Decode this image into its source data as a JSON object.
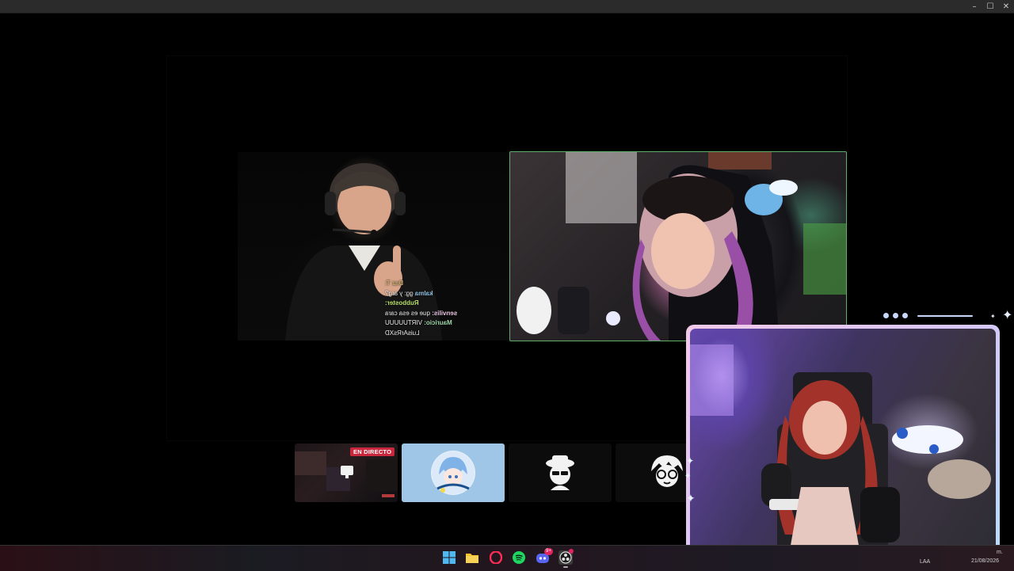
{
  "window": {
    "controls": {
      "minimize": "–",
      "maximize": "☐",
      "close": "✕"
    }
  },
  "stage": {
    "chat_overlay": [
      {
        "user": "Daz T:",
        "message": ""
      },
      {
        "user": "kalma",
        "message": "gg: y arg?"
      },
      {
        "user": "Rubboster:",
        "message": ""
      },
      {
        "user": "senvilis:",
        "message": "que es esa cara"
      },
      {
        "user": "Mauricio:",
        "message": "VIRTUUUUU"
      },
      {
        "user": "",
        "message": "LuisArRsXD"
      }
    ]
  },
  "thumbnails": [
    {
      "name": "stream-thumbnail-live",
      "live_label": "EN DIRECTO",
      "active": false
    },
    {
      "name": "stream-thumbnail-avatar-anime",
      "active": true
    },
    {
      "name": "stream-thumbnail-avatar-hat",
      "active": false
    },
    {
      "name": "stream-thumbnail-avatar-glasses",
      "active": false
    }
  ],
  "taskbar": {
    "icons": [
      "windows-start-icon",
      "file-explorer-icon",
      "opera-icon",
      "spotify-icon",
      "discord-icon",
      "obs-icon"
    ],
    "discord_badge": "9+",
    "tray": {
      "lang": "LAA",
      "time_partial": "m.",
      "date": "21/08/2026"
    }
  },
  "colors": {
    "live_badge": "#c8273d",
    "cam_border_start": "#f2c9e8",
    "cam_border_end": "#b8dcff",
    "active_tile_border": "#5fae6a"
  }
}
